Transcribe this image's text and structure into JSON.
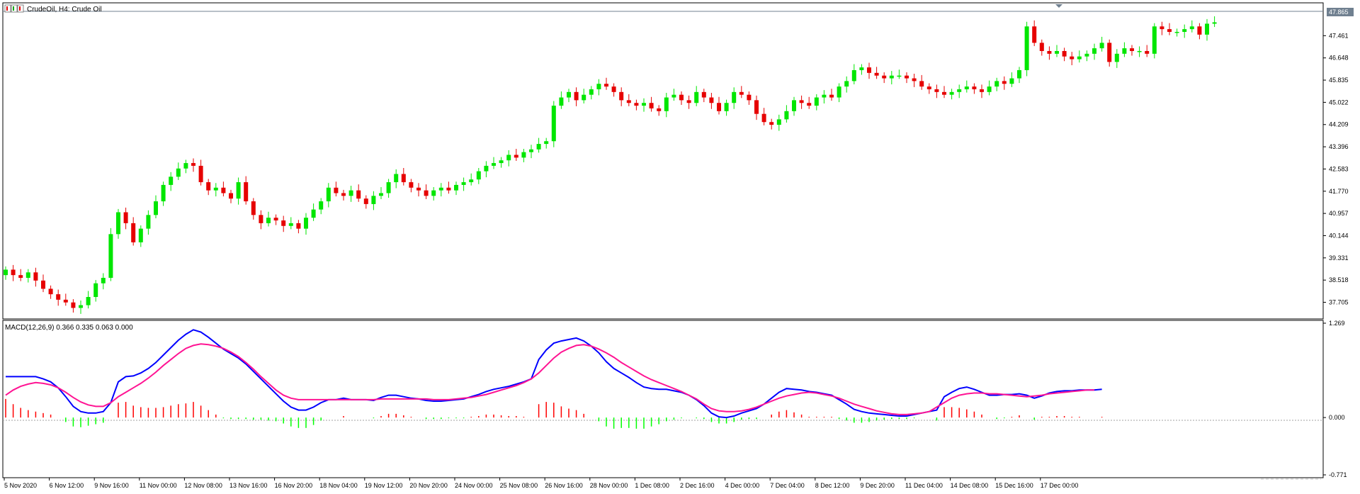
{
  "window": {
    "title": "CrudeOil, H4:  Crude Oil",
    "icon": "window-icons"
  },
  "chart_data": [
    {
      "type": "candlestick",
      "title": "CrudeOil, H4:  Crude Oil",
      "ylim": [
        37.2,
        48.3
      ],
      "y_ticks": [
        "47.461",
        "46.648",
        "45.835",
        "45.022",
        "44.209",
        "43.396",
        "42.583",
        "41.770",
        "40.957",
        "40.144",
        "39.331",
        "38.518",
        "37.705"
      ],
      "current_price": "47.865",
      "x_ticks": [
        "5 Nov 2020",
        "6 Nov 12:00",
        "9 Nov 16:00",
        "11 Nov 00:00",
        "12 Nov 08:00",
        "13 Nov 16:00",
        "16 Nov 20:00",
        "18 Nov 04:00",
        "19 Nov 12:00",
        "20 Nov 20:00",
        "24 Nov 00:00",
        "25 Nov 08:00",
        "26 Nov 16:00",
        "28 Nov 00:00",
        "1 Dec 08:00",
        "2 Dec 16:00",
        "4 Dec 00:00",
        "7 Dec 04:00",
        "8 Dec 12:00",
        "9 Dec 20:00",
        "11 Dec 04:00",
        "14 Dec 08:00",
        "15 Dec 16:00",
        "17 Dec 00:00"
      ],
      "up_color": "#00e600",
      "down_color": "#e60000",
      "close": [
        38.9,
        38.7,
        38.6,
        38.8,
        38.5,
        38.2,
        38.0,
        37.8,
        37.7,
        37.5,
        37.6,
        37.9,
        38.4,
        38.6,
        40.2,
        41.0,
        40.6,
        39.9,
        40.4,
        40.9,
        41.4,
        42.0,
        42.3,
        42.6,
        42.8,
        42.7,
        42.1,
        41.8,
        41.9,
        41.7,
        41.5,
        42.1,
        41.4,
        40.9,
        40.6,
        40.8,
        40.7,
        40.5,
        40.6,
        40.4,
        40.8,
        41.1,
        41.4,
        41.9,
        41.7,
        41.6,
        41.8,
        41.5,
        41.3,
        41.6,
        41.7,
        42.1,
        42.4,
        42.1,
        41.9,
        41.8,
        41.6,
        41.8,
        41.9,
        41.8,
        42.0,
        42.1,
        42.2,
        42.5,
        42.7,
        42.8,
        42.9,
        43.1,
        43.0,
        43.2,
        43.3,
        43.5,
        43.6,
        44.9,
        45.2,
        45.4,
        45.1,
        45.3,
        45.5,
        45.7,
        45.6,
        45.4,
        45.1,
        45.0,
        44.9,
        45.0,
        44.8,
        44.7,
        45.2,
        45.3,
        45.1,
        45.0,
        45.4,
        45.2,
        45.0,
        44.7,
        45.0,
        45.4,
        45.3,
        45.1,
        44.6,
        44.3,
        44.2,
        44.4,
        44.7,
        45.1,
        45.0,
        44.9,
        45.2,
        45.3,
        45.2,
        45.6,
        45.8,
        46.2,
        46.3,
        46.1,
        46.0,
        45.9,
        46.0,
        46.0,
        45.9,
        45.8,
        45.6,
        45.5,
        45.4,
        45.3,
        45.4,
        45.5,
        45.6,
        45.5,
        45.4,
        45.6,
        45.8,
        45.7,
        45.9,
        46.2,
        47.8,
        47.2,
        46.9,
        46.8,
        46.9,
        46.7,
        46.6,
        46.7,
        46.8,
        47.0,
        47.2,
        46.5,
        46.8,
        47.0,
        46.9,
        46.9,
        46.8,
        47.8,
        47.7,
        47.6,
        47.6,
        47.7,
        47.8,
        47.5,
        47.9,
        47.95
      ],
      "macd_panel": {
        "label": "MACD(12,26,9) 0.366 0.335 0.063 0.000",
        "ylim": [
          -0.771,
          1.269
        ],
        "y_ticks": [
          "1.269",
          "0.000",
          "-0.771"
        ],
        "macd_color": "#0000ff",
        "signal_color": "#ff1493",
        "hist_up_color": "#ff0000",
        "hist_down_color": "#00ff00",
        "macd": [
          0.55,
          0.55,
          0.55,
          0.55,
          0.55,
          0.52,
          0.48,
          0.4,
          0.28,
          0.15,
          0.08,
          0.06,
          0.06,
          0.08,
          0.2,
          0.48,
          0.55,
          0.56,
          0.6,
          0.66,
          0.74,
          0.84,
          0.94,
          1.04,
          1.12,
          1.18,
          1.15,
          1.08,
          1.0,
          0.92,
          0.86,
          0.8,
          0.72,
          0.62,
          0.52,
          0.42,
          0.32,
          0.22,
          0.14,
          0.1,
          0.1,
          0.14,
          0.2,
          0.24,
          0.24,
          0.26,
          0.24,
          0.24,
          0.24,
          0.23,
          0.27,
          0.3,
          0.3,
          0.28,
          0.26,
          0.25,
          0.23,
          0.22,
          0.22,
          0.23,
          0.24,
          0.25,
          0.28,
          0.31,
          0.35,
          0.38,
          0.4,
          0.42,
          0.45,
          0.48,
          0.52,
          0.78,
          0.91,
          1.0,
          1.03,
          1.05,
          1.07,
          1.03,
          0.96,
          0.87,
          0.75,
          0.66,
          0.6,
          0.54,
          0.47,
          0.41,
          0.39,
          0.38,
          0.38,
          0.36,
          0.34,
          0.3,
          0.24,
          0.16,
          0.06,
          0.01,
          0.0,
          0.02,
          0.06,
          0.09,
          0.12,
          0.18,
          0.26,
          0.34,
          0.39,
          0.38,
          0.37,
          0.35,
          0.34,
          0.32,
          0.3,
          0.24,
          0.18,
          0.11,
          0.08,
          0.06,
          0.05,
          0.04,
          0.03,
          0.02,
          0.02,
          0.04,
          0.06,
          0.08,
          0.1,
          0.28,
          0.34,
          0.39,
          0.41,
          0.38,
          0.34,
          0.3,
          0.3,
          0.31,
          0.31,
          0.32,
          0.3,
          0.26,
          0.29,
          0.33,
          0.35,
          0.36,
          0.36,
          0.37,
          0.37,
          0.37,
          0.38
        ],
        "signal": [
          0.3,
          0.37,
          0.42,
          0.45,
          0.47,
          0.46,
          0.44,
          0.4,
          0.34,
          0.27,
          0.21,
          0.17,
          0.15,
          0.15,
          0.2,
          0.28,
          0.34,
          0.4,
          0.46,
          0.53,
          0.61,
          0.7,
          0.78,
          0.86,
          0.93,
          0.97,
          0.99,
          0.98,
          0.96,
          0.93,
          0.88,
          0.82,
          0.74,
          0.65,
          0.55,
          0.46,
          0.37,
          0.3,
          0.26,
          0.24,
          0.24,
          0.24,
          0.24,
          0.24,
          0.24,
          0.24,
          0.24,
          0.24,
          0.24,
          0.24,
          0.25,
          0.25,
          0.25,
          0.25,
          0.25,
          0.25,
          0.25,
          0.24,
          0.24,
          0.24,
          0.25,
          0.26,
          0.27,
          0.29,
          0.31,
          0.34,
          0.37,
          0.4,
          0.43,
          0.47,
          0.52,
          0.6,
          0.7,
          0.8,
          0.88,
          0.93,
          0.97,
          0.98,
          0.96,
          0.92,
          0.87,
          0.81,
          0.74,
          0.68,
          0.62,
          0.56,
          0.51,
          0.47,
          0.43,
          0.39,
          0.35,
          0.3,
          0.25,
          0.18,
          0.12,
          0.09,
          0.08,
          0.08,
          0.09,
          0.11,
          0.14,
          0.18,
          0.22,
          0.26,
          0.29,
          0.31,
          0.33,
          0.34,
          0.33,
          0.31,
          0.29,
          0.26,
          0.22,
          0.18,
          0.15,
          0.12,
          0.09,
          0.07,
          0.05,
          0.04,
          0.04,
          0.05,
          0.06,
          0.08,
          0.14,
          0.2,
          0.26,
          0.3,
          0.32,
          0.33,
          0.33,
          0.32,
          0.32,
          0.31,
          0.3,
          0.29,
          0.28,
          0.29,
          0.3,
          0.32,
          0.33,
          0.34,
          0.35,
          0.36,
          0.37,
          0.37
        ],
        "histogram": [
          0.25,
          0.18,
          0.13,
          0.1,
          0.08,
          0.06,
          0.04,
          0.0,
          -0.06,
          -0.12,
          -0.13,
          -0.11,
          -0.09,
          -0.07,
          0.0,
          0.2,
          0.21,
          0.16,
          0.14,
          0.13,
          0.13,
          0.14,
          0.16,
          0.18,
          0.19,
          0.21,
          0.16,
          0.1,
          0.04,
          -0.01,
          -0.02,
          -0.02,
          -0.02,
          -0.03,
          -0.03,
          -0.04,
          -0.05,
          -0.08,
          -0.12,
          -0.14,
          -0.14,
          -0.1,
          -0.04,
          0.0,
          0.0,
          0.02,
          0.0,
          0.0,
          0.0,
          -0.01,
          0.02,
          0.05,
          0.05,
          0.03,
          0.01,
          0.0,
          -0.02,
          -0.02,
          -0.02,
          -0.01,
          -0.01,
          -0.01,
          0.01,
          0.02,
          0.04,
          0.04,
          0.03,
          0.02,
          0.02,
          0.01,
          0.0,
          0.18,
          0.21,
          0.2,
          0.15,
          0.12,
          0.1,
          0.05,
          0.0,
          -0.05,
          -0.12,
          -0.15,
          -0.14,
          -0.14,
          -0.15,
          -0.15,
          -0.12,
          -0.09,
          -0.05,
          -0.03,
          -0.01,
          0.0,
          -0.01,
          -0.02,
          -0.06,
          -0.08,
          -0.08,
          -0.06,
          -0.03,
          -0.02,
          -0.02,
          0.0,
          0.04,
          0.08,
          0.1,
          0.07,
          0.04,
          0.01,
          0.01,
          0.01,
          0.01,
          -0.02,
          -0.04,
          -0.07,
          -0.07,
          -0.06,
          -0.04,
          -0.03,
          -0.02,
          -0.02,
          -0.02,
          -0.01,
          0.0,
          0.0,
          -0.04,
          0.14,
          0.14,
          0.13,
          0.11,
          0.08,
          0.04,
          0.0,
          -0.02,
          -0.01,
          0.01,
          0.03,
          0.0,
          -0.03,
          0.01,
          0.01,
          0.02,
          0.02,
          0.01,
          0.01,
          0.0,
          0.0,
          0.01
        ]
      }
    }
  ]
}
